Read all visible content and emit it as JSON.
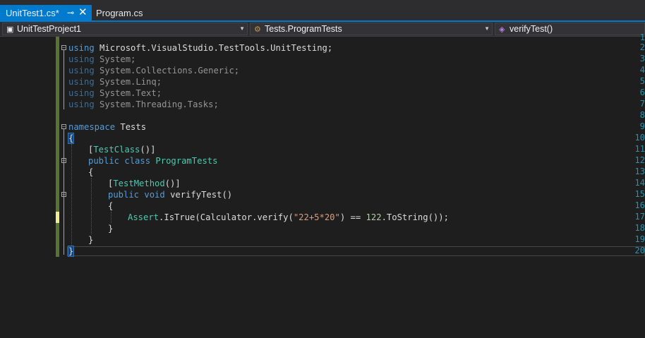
{
  "tabs": [
    {
      "label": "UnitTest1.cs*",
      "active": true,
      "pin_icon": "pin-icon",
      "close_icon": "close-icon"
    },
    {
      "label": "Program.cs",
      "active": false
    }
  ],
  "navbar": {
    "project": "UnitTestProject1",
    "class": "Tests.ProgramTests",
    "member": "verifyTest()"
  },
  "line_numbers": [
    "1",
    "2",
    "3",
    "4",
    "5",
    "6",
    "7",
    "8",
    "9",
    "10",
    "11",
    "12",
    "13",
    "14",
    "15",
    "16",
    "17",
    "18",
    "19",
    "20"
  ],
  "code": {
    "l2": [
      "using",
      " Microsoft.VisualStudio.TestTools.UnitTesting;"
    ],
    "l3": [
      "using",
      " System;"
    ],
    "l4": [
      "using",
      " System.Collections.Generic;"
    ],
    "l5": [
      "using",
      " System.Linq;"
    ],
    "l6": [
      "using",
      " System.Text;"
    ],
    "l7": [
      "using",
      " System.Threading.Tasks;"
    ],
    "l9": [
      "namespace",
      " Tests"
    ],
    "l10": "{",
    "l11": [
      "[",
      "TestClass",
      "()]"
    ],
    "l12": [
      "public",
      " ",
      "class",
      " ",
      "ProgramTests"
    ],
    "l13": "{",
    "l14": [
      "[",
      "TestMethod",
      "()]"
    ],
    "l15": [
      "public",
      " ",
      "void",
      " verifyTest()"
    ],
    "l16": "{",
    "l17": [
      "Assert",
      ".IsTrue(Calculator.verify(",
      "\"22+5*20\"",
      ") == ",
      "122",
      ".ToString());"
    ],
    "l18": "}",
    "l19": "}",
    "l20": "}"
  },
  "colors": {
    "accent": "#007acc",
    "keyword": "#569cd6",
    "type": "#4ec9b0",
    "string": "#d69d85",
    "number": "#b5cea8",
    "saved_change": "#577430",
    "unsaved_change": "#efef91"
  }
}
